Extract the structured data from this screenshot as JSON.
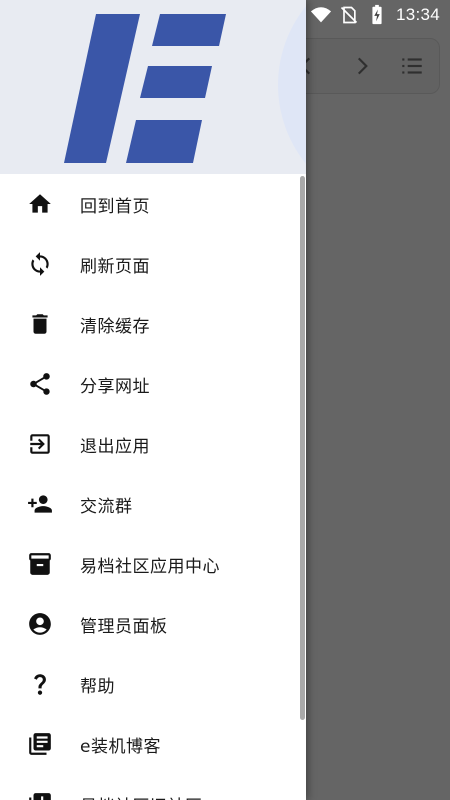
{
  "status_bar": {
    "time": "13:34",
    "icons": [
      "wifi-icon",
      "no-sim-icon",
      "battery-charging-icon"
    ]
  },
  "header": {
    "logo": "e-logo"
  },
  "colors": {
    "logo_blue": "#3a56a8",
    "header_bg": "#e8ebf2",
    "scrim": "#6b6b6b"
  },
  "menu": {
    "items": [
      {
        "label": "回到首页",
        "icon": "home-icon"
      },
      {
        "label": "刷新页面",
        "icon": "refresh-icon"
      },
      {
        "label": "清除缓存",
        "icon": "trash-icon"
      },
      {
        "label": "分享网址",
        "icon": "share-icon"
      },
      {
        "label": "退出应用",
        "icon": "exit-icon"
      },
      {
        "label": "交流群",
        "icon": "add-person-icon"
      },
      {
        "label": "易档社区应用中心",
        "icon": "archive-icon"
      },
      {
        "label": "管理员面板",
        "icon": "account-circle-icon"
      },
      {
        "label": "帮助",
        "icon": "help-icon"
      },
      {
        "label": "e装机博客",
        "icon": "library-books-icon"
      },
      {
        "label": "易档社区旧社区",
        "icon": "library-add-icon"
      }
    ]
  },
  "background_toolbar": {
    "icons": [
      "back-icon",
      "forward-icon",
      "list-menu-icon"
    ]
  }
}
